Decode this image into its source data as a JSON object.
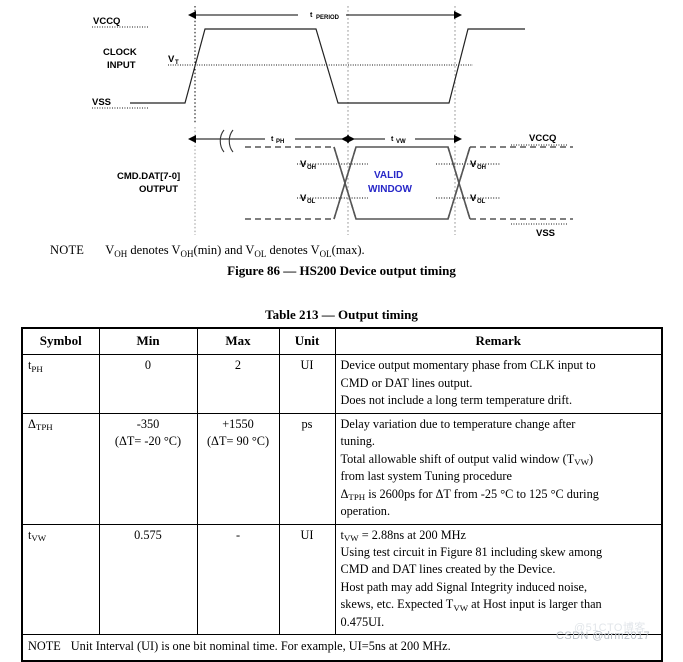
{
  "figure": {
    "signals": {
      "clock_label_line1": "CLOCK",
      "clock_label_line2": "INPUT",
      "vccq_top": "VCCQ",
      "vss_top": "VSS",
      "vt": "V",
      "vt_sub": "T",
      "output_label_line1": "CMD.DAT[7-0]",
      "output_label_line2": "OUTPUT",
      "vccq_right": "VCCQ",
      "vss_right": "VSS",
      "voh_left": "V",
      "voh_left_sub": "OH",
      "vol_left": "V",
      "vol_left_sub": "OL",
      "voh_right": "V",
      "voh_right_sub": "OH",
      "vol_right": "V",
      "vol_right_sub": "OL",
      "valid_line1": "VALID",
      "valid_line2": "WINDOW"
    },
    "dimensions": {
      "period": "t",
      "period_sub": "PERIOD",
      "tph": "t",
      "tph_sub": "PH",
      "tvw": "t",
      "tvw_sub": "VW"
    },
    "note": {
      "keyword": "NOTE",
      "text_1": "V",
      "sub_1": "OH",
      "text_2": " denotes V",
      "sub_2": "OH",
      "text_3": "(min) and V",
      "sub_3": "OL",
      "text_4": " denotes V",
      "sub_4": "OL",
      "text_5": "(max)."
    },
    "caption": "Figure 86 — HS200 Device output timing",
    "colors": {
      "valid_window_text": "#2727c8",
      "waveform": "#000000",
      "dashed_envelope": "#555555"
    }
  },
  "table": {
    "title": "Table 213 — Output timing",
    "headers": [
      "Symbol",
      "Min",
      "Max",
      "Unit",
      "Remark"
    ],
    "rows": [
      {
        "symbol_main": "t",
        "symbol_sub": "PH",
        "min": "0",
        "min_extra": "",
        "max": "2",
        "max_extra": "",
        "unit": "UI",
        "remark_lines": [
          "Device output momentary phase from CLK input to",
          "CMD or DAT lines output.",
          "Does not include a long term temperature drift."
        ]
      },
      {
        "symbol_main": "Δ",
        "symbol_sub": "TPH",
        "min": "-350",
        "min_extra": "(ΔT= -20 °C)",
        "max": "+1550",
        "max_extra": "(ΔT= 90 °C)",
        "unit": "ps",
        "remark_lines": [
          "Delay variation due to temperature change after",
          "tuning.",
          "Total allowable shift of output valid window (T_VW)",
          "from last system Tuning procedure",
          "Δ_TPH is 2600ps for ΔT from -25 °C to 125 °C during",
          "operation."
        ]
      },
      {
        "symbol_main": "t",
        "symbol_sub": "VW",
        "min": "0.575",
        "min_extra": "",
        "max": "-",
        "max_extra": "",
        "unit": "UI",
        "remark_lines": [
          "t_VW = 2.88ns at 200 MHz",
          "Using test circuit in Figure 81 including skew among",
          "CMD and DAT lines created by the Device.",
          "Host path may add Signal Integrity induced noise,",
          "skews, etc. Expected T_VW at Host input is larger than",
          "0.475UI."
        ]
      }
    ],
    "footer_note": {
      "label": "NOTE",
      "text": "Unit Interval (UI) is one bit nominal time. For example, UI=5ns at 200 MHz."
    }
  },
  "watermark": {
    "primary": "CSDN @drm2017",
    "secondary": "@51CTO博客"
  }
}
